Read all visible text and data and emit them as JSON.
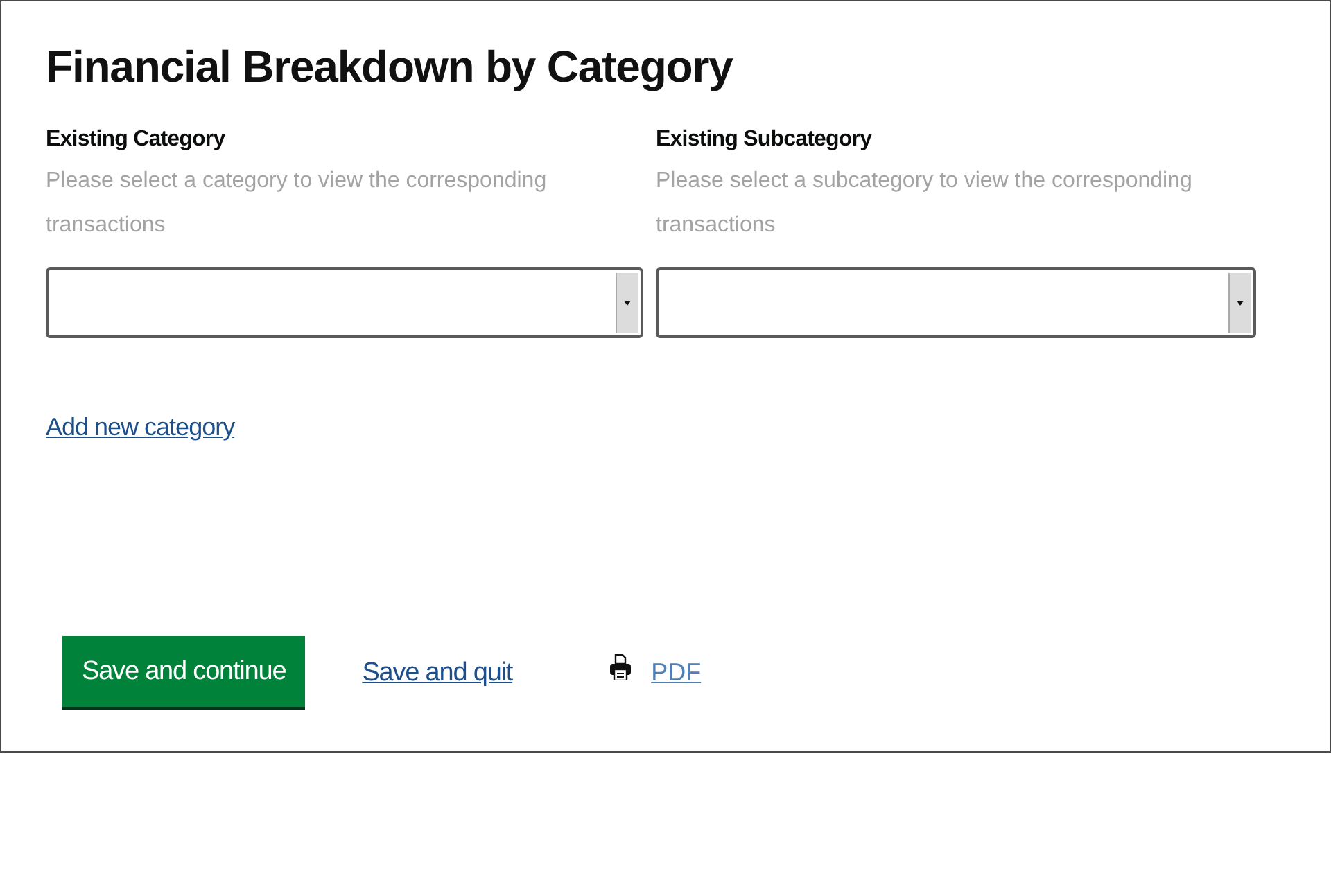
{
  "page": {
    "title": "Financial Breakdown by Category"
  },
  "fields": [
    {
      "label": "Existing Category",
      "hint": "Please select a category to view the corresponding transactions"
    },
    {
      "label": "Existing Subcategory",
      "hint": "Please select a subcategory to view the corresponding transactions"
    }
  ],
  "add_link": "Add new category",
  "actions": [
    {
      "kind": "primary",
      "label": "Save and continue"
    },
    {
      "kind": "link",
      "label": "Save and quit"
    },
    {
      "kind": "pdf",
      "label": "PDF"
    }
  ]
}
